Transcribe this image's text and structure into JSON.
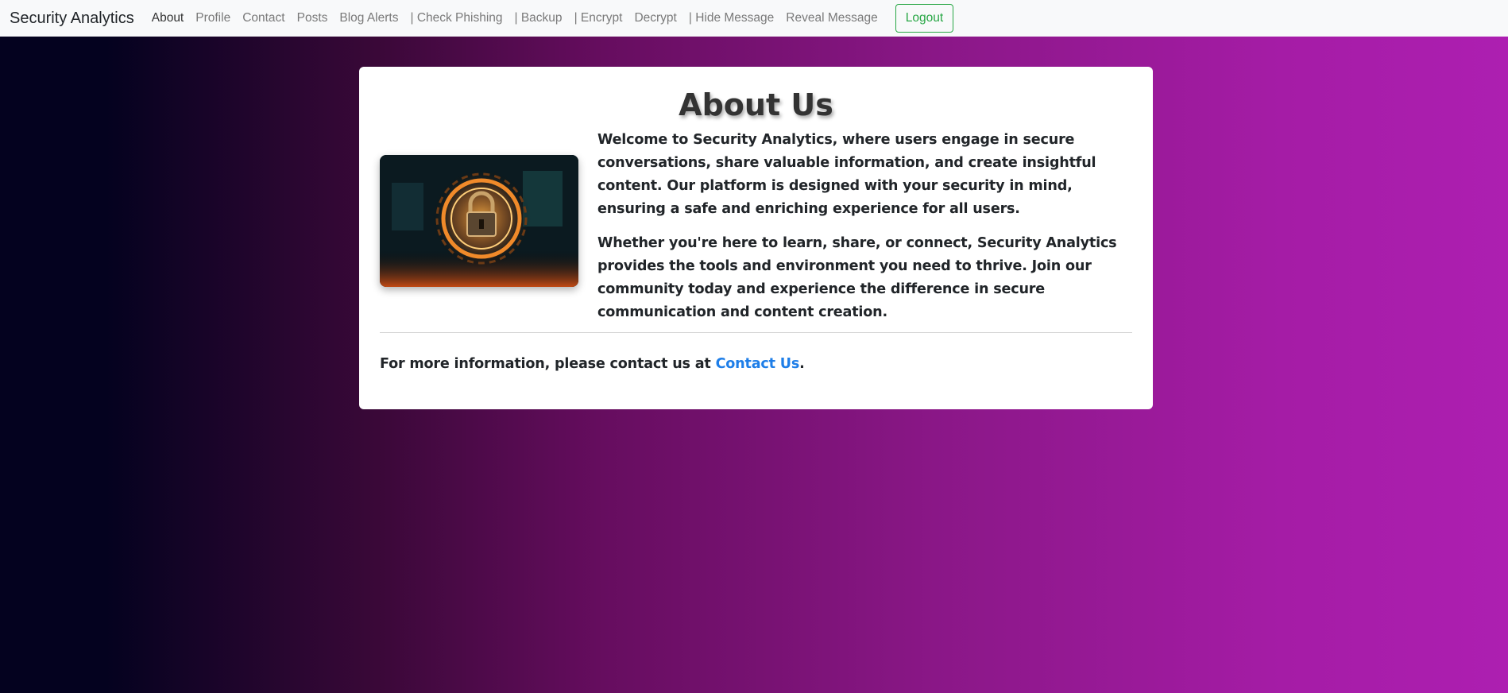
{
  "navbar": {
    "brand": "Security Analytics",
    "links": [
      {
        "label": "About"
      },
      {
        "label": "Profile"
      },
      {
        "label": "Contact"
      },
      {
        "label": "Posts"
      },
      {
        "label": "Blog Alerts"
      },
      {
        "label": "| Check Phishing"
      },
      {
        "label": "| Backup"
      },
      {
        "label": "| Encrypt"
      },
      {
        "label": "Decrypt"
      },
      {
        "label": "| Hide Message"
      },
      {
        "label": "Reveal Message"
      }
    ],
    "logout_label": "Logout"
  },
  "card": {
    "title": "About Us",
    "image_icon": "padlock-image",
    "paragraph_1": "Welcome to Security Analytics, where users engage in secure conversations, share valuable information, and create insightful content. Our platform is designed with your security in mind, ensuring a safe and enriching experience for all users.",
    "paragraph_2": "Whether you're here to learn, share, or connect, Security Analytics provides the tools and environment you need to thrive. Join our community today and experience the difference in secure communication and content creation.",
    "footer_prefix": "For more information, please contact us at ",
    "footer_link": "Contact Us",
    "footer_suffix": "."
  },
  "colors": {
    "background_start": "#04021f",
    "background_end": "#ad1fb1",
    "logout_green": "#28a745",
    "link_blue": "#1e7ee8"
  }
}
